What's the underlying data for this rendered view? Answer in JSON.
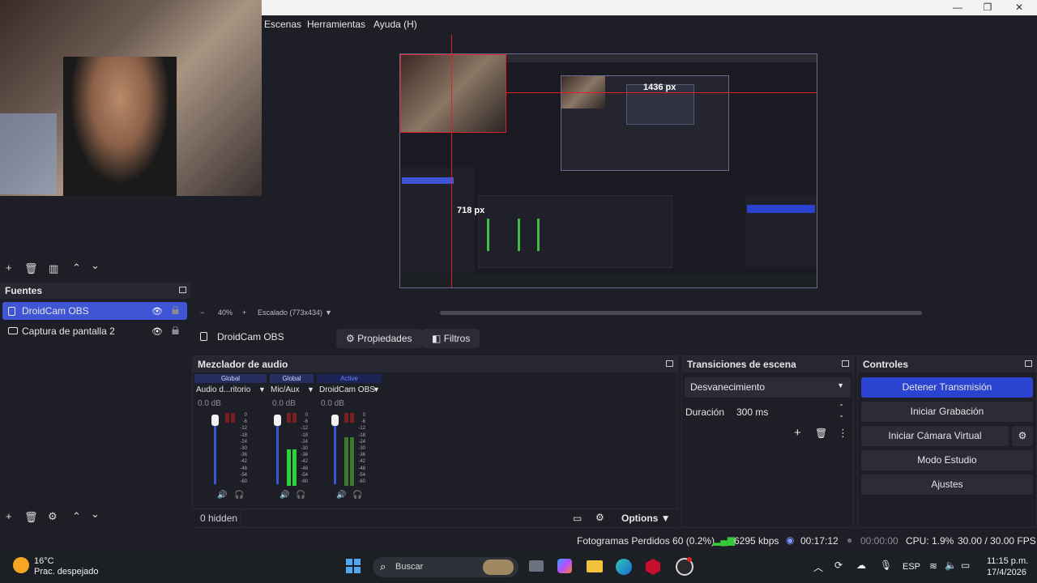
{
  "menu": {
    "items": [
      "Escenas",
      "Herramientas",
      "Ayuda (H)"
    ]
  },
  "window": {
    "minimize": "—",
    "maximize": "❐",
    "close": "✕"
  },
  "preview": {
    "width_label": "1436 px",
    "height_label": "718 px"
  },
  "zoombar": {
    "minus": "−",
    "zoom": "40%",
    "plus": "+",
    "scaling": "Escalado (773x434)"
  },
  "sources": {
    "title": "Fuentes",
    "items": [
      {
        "label": "DroidCam OBS",
        "selected": true,
        "icon": "document-icon"
      },
      {
        "label": "Captura de pantalla 2",
        "selected": false,
        "icon": "monitor-icon"
      }
    ]
  },
  "source_toolbar": {
    "name": "DroidCam OBS",
    "properties": "Propiedades",
    "filters": "Filtros"
  },
  "mixer": {
    "title": "Mezclador de audio",
    "hidden_label": "0 hidden",
    "options_label": "Options",
    "channels": [
      {
        "head": "Global",
        "name": "Audio d...ritorio",
        "db": "0.0 dB"
      },
      {
        "head": "Global",
        "name": "Mic/Aux",
        "db": "0.0 dB"
      },
      {
        "head": "Active",
        "name": "DroidCam OBS",
        "db": "0.0 dB"
      }
    ],
    "scale": [
      "0",
      "-6",
      "-12",
      "-18",
      "-24",
      "-30",
      "-36",
      "-42",
      "-48",
      "-54",
      "-60"
    ]
  },
  "transitions": {
    "title": "Transiciones de escena",
    "selected": "Desvanecimiento",
    "duration_label": "Duración",
    "duration_value": "300 ms"
  },
  "controls": {
    "title": "Controles",
    "buttons": [
      "Detener Transmisión",
      "Iniciar Grabación",
      "Iniciar Cámara Virtual",
      "Modo Estudio",
      "Ajustes"
    ]
  },
  "status": {
    "dropped": "Fotogramas Perdidos 60 (0.2%)",
    "bitrate": "6295 kbps",
    "stream_time": "00:17:12",
    "rec_time": "00:00:00",
    "cpu": "CPU: 1.9%",
    "fps": "30.00 / 30.00 FPS"
  },
  "taskbar": {
    "weather_temp": "16°C",
    "weather_desc": "Prac. despejado",
    "search_placeholder": "Buscar",
    "lang": "ESP",
    "time": "11:15 p.m.",
    "date": "17/4/2026"
  },
  "colors": {
    "accent": "#2b44cf",
    "selected": "#3f55d6",
    "guide": "#e0202a",
    "background": "#1e1e26"
  }
}
